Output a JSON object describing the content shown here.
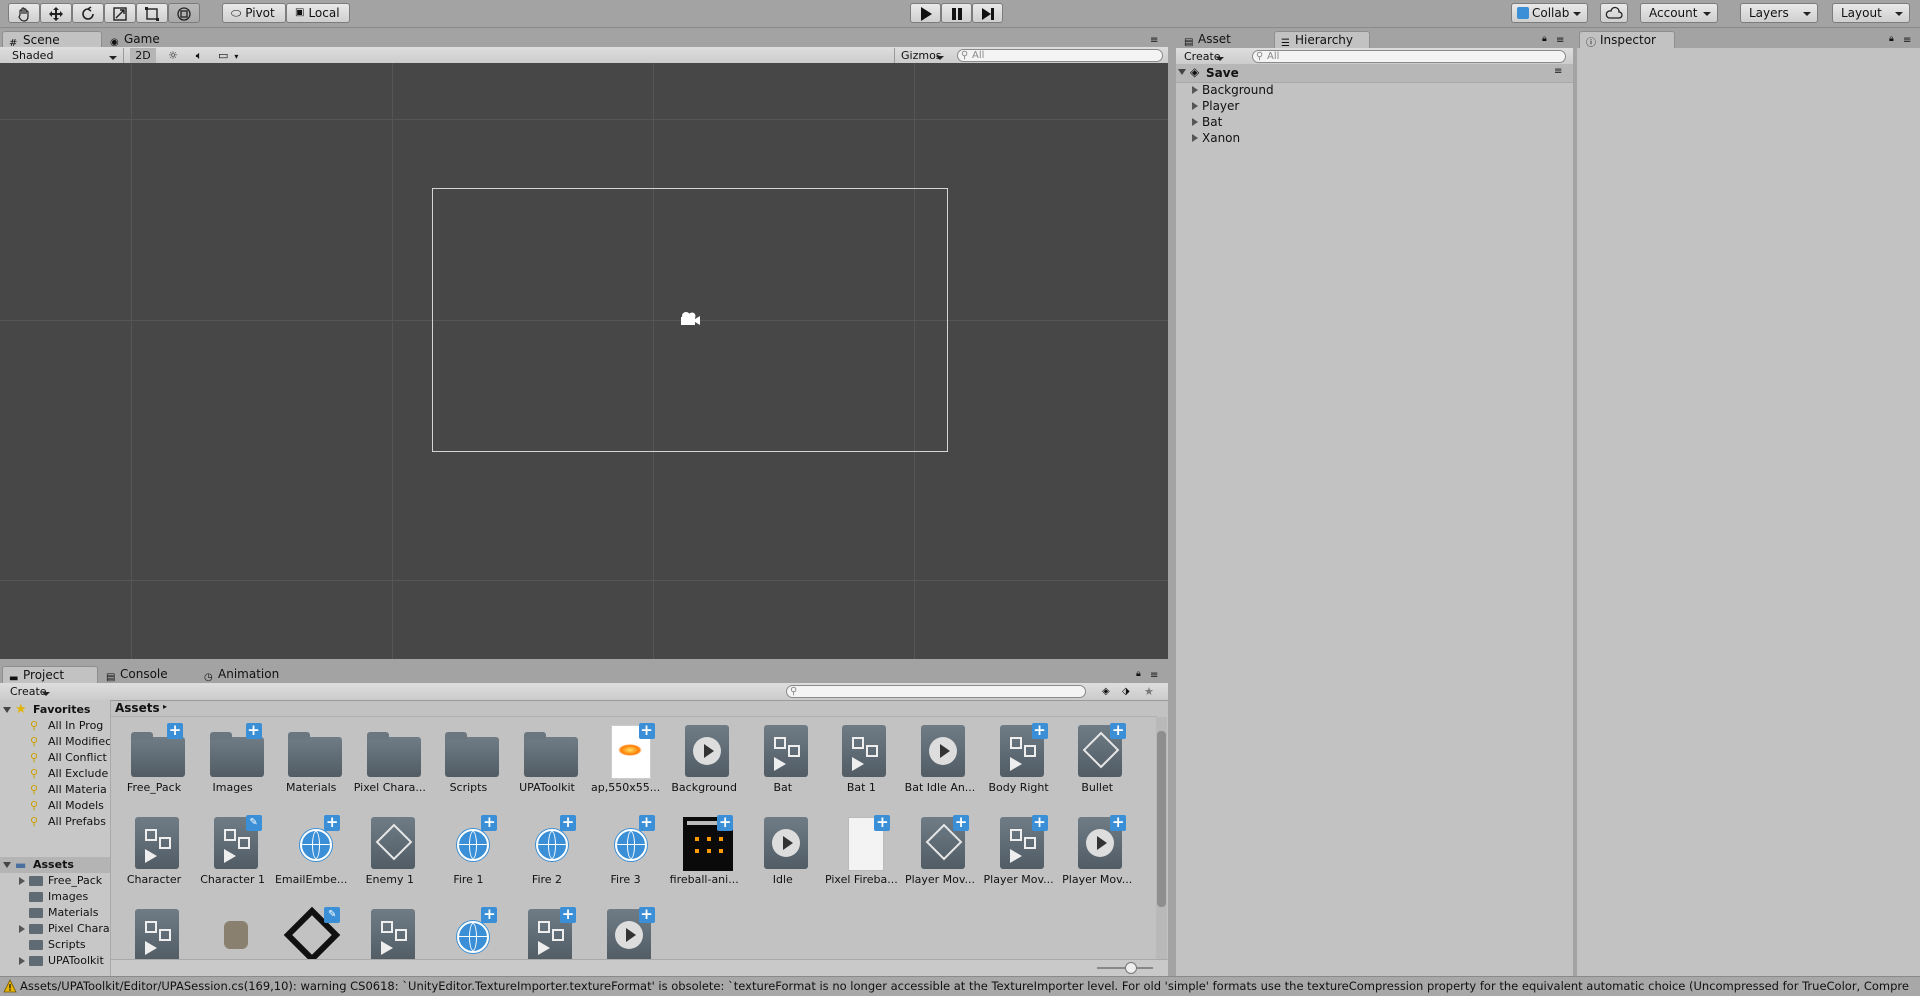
{
  "toolbar": {
    "pivot": "Pivot",
    "local": "Local",
    "collab": "Collab",
    "account": "Account",
    "layers": "Layers",
    "layout": "Layout"
  },
  "scene_panel": {
    "tabs": [
      {
        "label": "Scene"
      },
      {
        "label": "Game"
      }
    ],
    "shading": "Shaded",
    "mode_2d": "2D",
    "gizmos": "Gizmos",
    "search_placeholder": "All"
  },
  "hierarchy_panel": {
    "tabs": [
      {
        "label": "Asset Store"
      },
      {
        "label": "Hierarchy"
      }
    ],
    "create": "Create",
    "search_placeholder": "All",
    "scene_name": "Save",
    "items": [
      {
        "label": "Background"
      },
      {
        "label": "Player"
      },
      {
        "label": "Bat"
      },
      {
        "label": "Xanon"
      }
    ]
  },
  "inspector_panel": {
    "tab": "Inspector"
  },
  "project_panel": {
    "tabs": [
      {
        "label": "Project"
      },
      {
        "label": "Console"
      },
      {
        "label": "Animation"
      }
    ],
    "create": "Create",
    "favorites_label": "Favorites",
    "favorites": [
      "All In Prog",
      "All Modifiec",
      "All Conflict",
      "All Exclude",
      "All Materia",
      "All Models",
      "All Prefabs"
    ],
    "assets_label": "Assets",
    "asset_folders": [
      "Free_Pack",
      "Images",
      "Materials",
      "Pixel Chara",
      "Scripts",
      "UPAToolkit"
    ],
    "breadcrumb": "Assets",
    "assets_row1": [
      "Free_Pack",
      "Images",
      "Materials",
      "Pixel Chara...",
      "Scripts",
      "UPAToolkit",
      "ap,550x55...",
      "Background",
      "Bat",
      "Bat 1",
      "Bat Idle An...",
      "Body Right",
      "Bullet"
    ],
    "assets_row2": [
      "Character",
      "Character 1",
      "EmailEmbe...",
      "Enemy 1",
      "Fire 1",
      "Fire 2",
      "Fire 3",
      "fireball-ani...",
      "Idle",
      "Pixel Fireba...",
      "Player Mov...",
      "Player Mov...",
      "Player Mov..."
    ]
  },
  "status_bar": {
    "message": "Assets/UPAToolkit/Editor/UPASession.cs(169,10): warning CS0618: `UnityEditor.TextureImporter.textureFormat' is obsolete: `textureFormat is no longer accessible at the TextureImporter level. For old 'simple' formats use the textureCompression property for the equivalent automatic choice (Uncompressed for TrueColor, Compre"
  },
  "colors": {
    "editor_bg": "#c2c2c2",
    "scene_bg": "#474747",
    "accent": "#3a8fd6",
    "warning": "#e8b400"
  }
}
